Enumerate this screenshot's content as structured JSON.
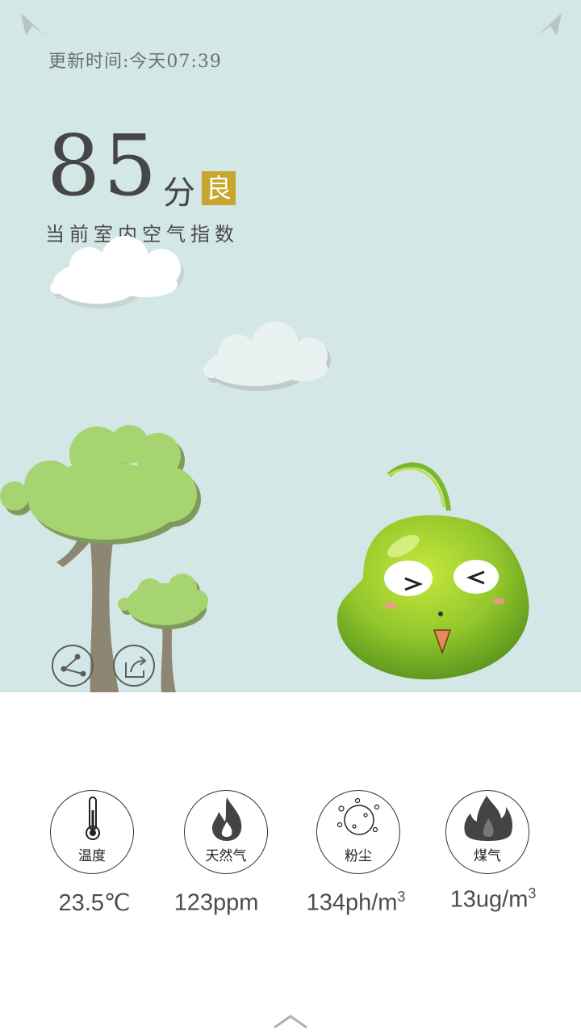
{
  "header": {
    "update_time": "更新时间:今天07:39",
    "score": "85",
    "score_unit": "分",
    "grade": "良",
    "subtitle": "当前室内空气指数"
  },
  "actions": {
    "share_icon": "share-nodes-icon",
    "export_icon": "share-export-icon"
  },
  "sensors": [
    {
      "label": "温度",
      "value": "23.5℃",
      "value_sup": "",
      "icon": "thermometer-icon"
    },
    {
      "label": "天然气",
      "value": "123ppm",
      "value_sup": "",
      "icon": "flame-icon"
    },
    {
      "label": "粉尘",
      "value": "134ph/m",
      "value_sup": "3",
      "icon": "dust-icon"
    },
    {
      "label": "煤气",
      "value": "13ug/m",
      "value_sup": "3",
      "icon": "gas-flame-icon"
    }
  ],
  "colors": {
    "sky": "#d3e7e6",
    "grade_bg": "#c8a62e",
    "tree": "#a6d470",
    "mascot": "#86c42b"
  }
}
